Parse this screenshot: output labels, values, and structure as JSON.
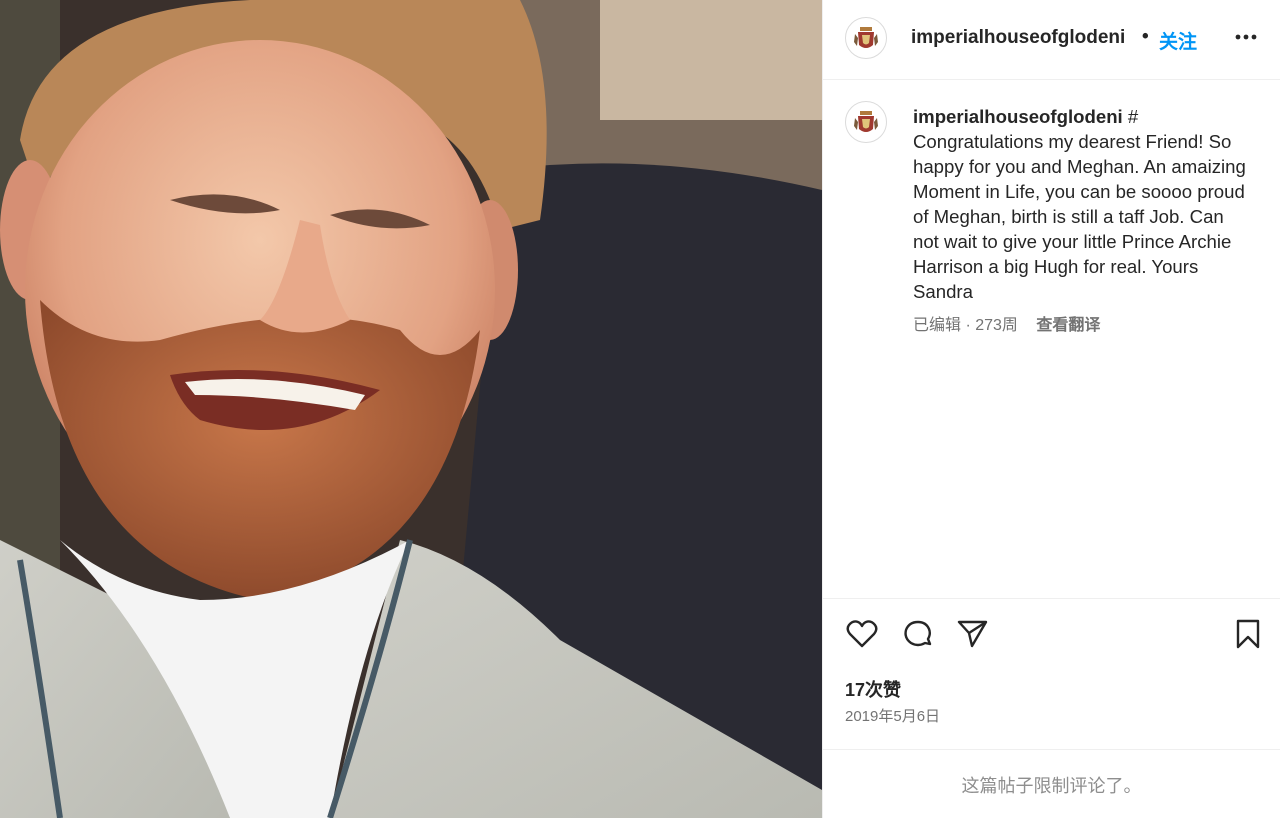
{
  "post": {
    "username": "imperialhouseofglodeni",
    "separator": "•",
    "follow_label": "关注",
    "more_icon": "more-horizontal-icon",
    "avatar_icon": "royal-crest-icon",
    "caption_username": "imperialhouseofglodeni",
    "caption_text": " # Congratulations my dearest Friend! So happy for you and Meghan. An amaizing Moment in Life, you can be soooo proud of Meghan, birth is still a taff Job. Can not wait to give your little Prince Archie Harrison a big Hugh for real. Yours Sandra",
    "edited_label": "已编辑 · 273周",
    "translate_label": "查看翻译",
    "likes_label": "17次赞",
    "date_label": "2019年5月6日",
    "comments_limited_label": "这篇帖子限制评论了。"
  },
  "actions": {
    "like_icon": "heart-icon",
    "comment_icon": "comment-icon",
    "share_icon": "paper-plane-icon",
    "save_icon": "bookmark-icon"
  },
  "media": {
    "description_icon": "photo-image"
  }
}
